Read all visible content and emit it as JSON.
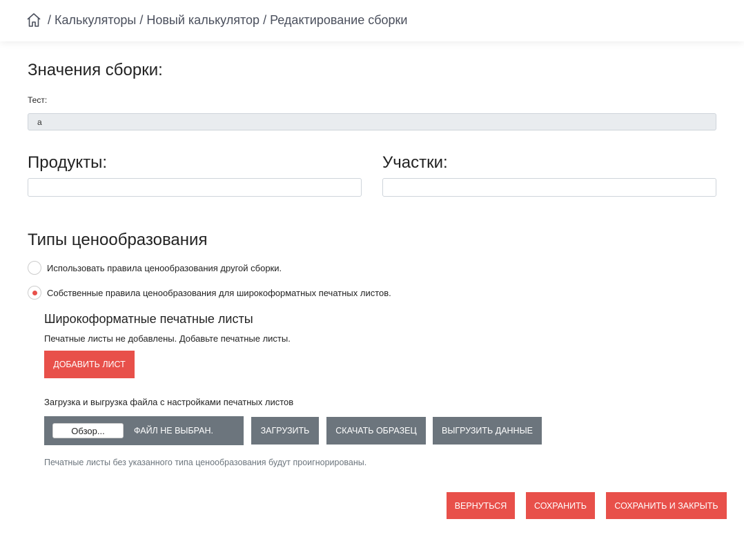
{
  "breadcrumb": {
    "separator": "/",
    "items": [
      "Калькуляторы",
      "Новый калькулятор",
      "Редактирование сборки"
    ]
  },
  "values": {
    "title": "Значения сборки:",
    "test_label": "Тест:",
    "test_value": "a"
  },
  "products": {
    "title": "Продукты:",
    "value": ""
  },
  "areas": {
    "title": "Участки:",
    "value": ""
  },
  "pricing": {
    "title": "Типы ценообразования",
    "options": [
      {
        "label": "Использовать правила ценообразования другой сборки.",
        "selected": false
      },
      {
        "label": "Собственные правила ценообразования для широкоформатных печатных листов.",
        "selected": true
      }
    ]
  },
  "sheets": {
    "title": "Широкоформатные печатные листы",
    "empty_text": "Печатные листы не добавлены. Добавьте печатные листы.",
    "add_button": "Добавить лист",
    "upload_label": "Загрузка и выгрузка файла с настройками печатных листов",
    "browse_label": "Обзор...",
    "file_status": "Файл не выбран.",
    "load_button": "Загрузить",
    "sample_button": "Скачать образец",
    "export_button": "Выгрузить данные",
    "hint": "Печатные листы без указанного типа ценообразования будут проигнорированы."
  },
  "footer": {
    "back_button": "Вернуться",
    "save_button": "Сохранить",
    "save_close_button": "Сохранить и закрыть"
  },
  "colors": {
    "accent": "#e8504a",
    "secondary": "#6c757d",
    "input_disabled": "#e9ecef"
  }
}
